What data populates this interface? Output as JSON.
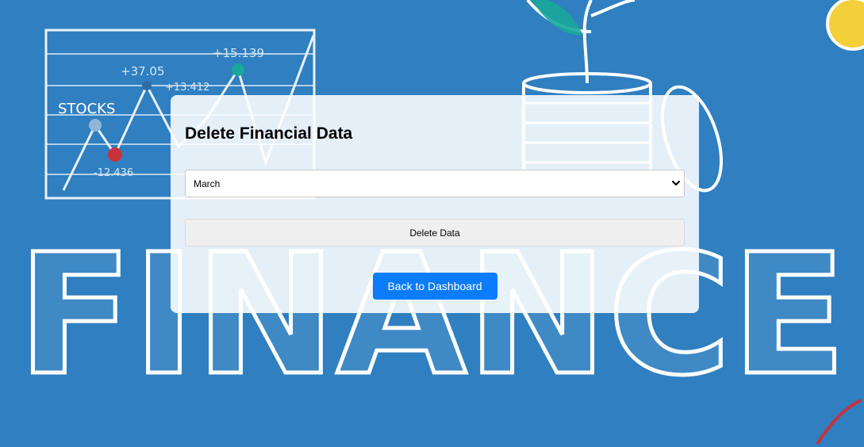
{
  "background": {
    "word": "FINANCE",
    "chart_label": "STOCKS",
    "annotations": [
      "+37.05",
      "+15.139",
      "-12.436",
      "+13.412"
    ],
    "color": "#2f7fc1"
  },
  "card": {
    "title": "Delete Financial Data",
    "month_select": {
      "selected": "March"
    },
    "delete_button_label": "Delete Data",
    "back_button_label": "Back to Dashboard",
    "accent_color": "#0a7cff"
  }
}
